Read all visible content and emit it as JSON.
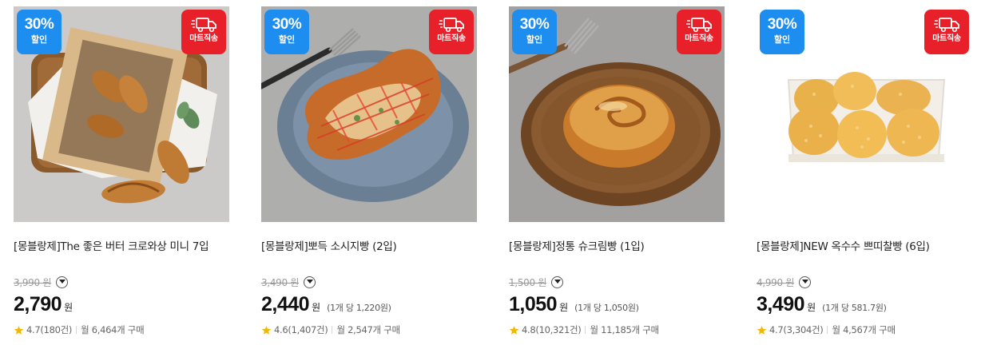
{
  "products": [
    {
      "discount_pct": "30%",
      "discount_label": "할인",
      "delivery_label": "마트직송",
      "name": "[몽블랑제]The 좋은 버터 크로와상 미니 7입",
      "original_price": "3,990 원",
      "price": "2,790",
      "won": "원",
      "unit_price": "",
      "rating": "4.7(180건)",
      "purchases": "월 6,464개 구매"
    },
    {
      "discount_pct": "30%",
      "discount_label": "할인",
      "delivery_label": "마트직송",
      "name": "[몽블랑제]뽀득 소시지빵 (2입)",
      "original_price": "3,490 원",
      "price": "2,440",
      "won": "원",
      "unit_price": "(1개 당 1,220원)",
      "rating": "4.6(1,407건)",
      "purchases": "월 2,547개 구매"
    },
    {
      "discount_pct": "30%",
      "discount_label": "할인",
      "delivery_label": "마트직송",
      "name": "[몽블랑제]정통 슈크림빵 (1입)",
      "original_price": "1,500 원",
      "price": "1,050",
      "won": "원",
      "unit_price": "(1개 당 1,050원)",
      "rating": "4.8(10,321건)",
      "purchases": "월 11,185개 구매"
    },
    {
      "discount_pct": "30%",
      "discount_label": "할인",
      "delivery_label": "마트직송",
      "name": "[몽블랑제]NEW 옥수수 쁘띠찰빵 (6입)",
      "original_price": "4,990 원",
      "price": "3,490",
      "won": "원",
      "unit_price": "(1개 당 581.7원)",
      "rating": "4.7(3,304건)",
      "purchases": "월 4,567개 구매"
    }
  ],
  "icons": {
    "discount_badge": "discount-badge",
    "delivery": "delivery-truck-icon",
    "info": "chevron-down-circle-icon",
    "star": "star-icon"
  },
  "colors": {
    "discount_badge": "#1d8ef0",
    "delivery_badge": "#e8202a",
    "star": "#f5b800",
    "strikethrough": "#999999"
  }
}
